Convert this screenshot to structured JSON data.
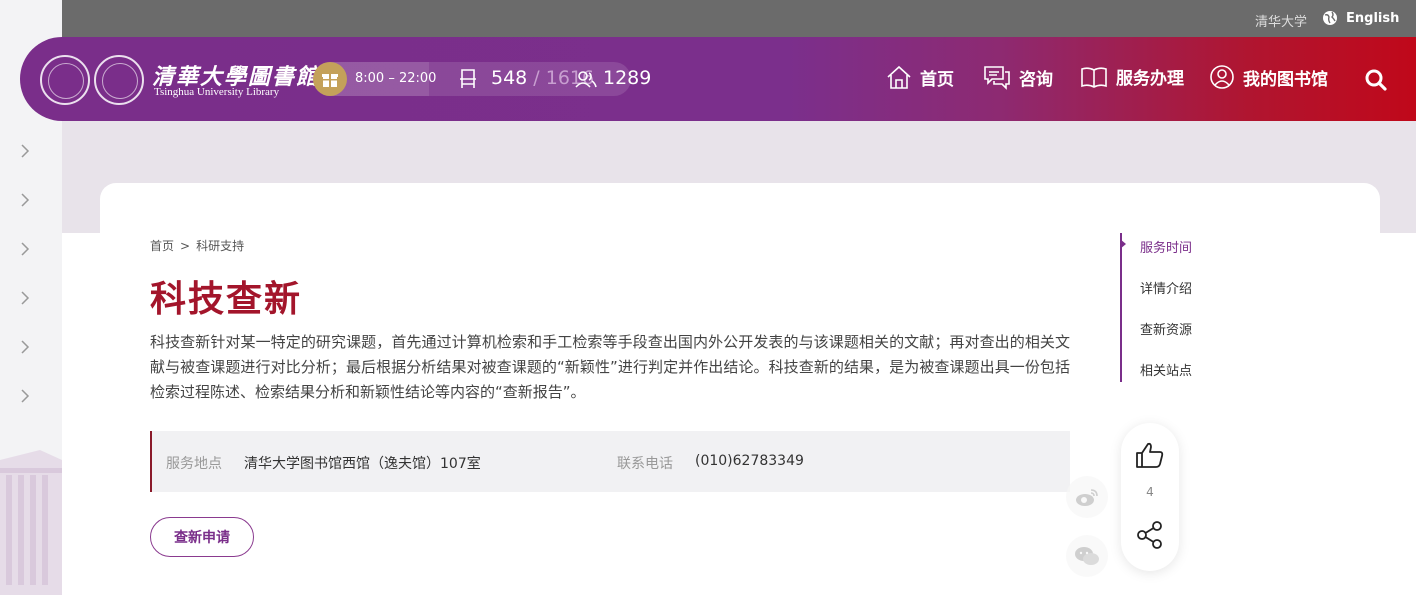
{
  "topbar": {
    "university_link": "清华大学",
    "language_label": "English"
  },
  "header": {
    "logo_cn": "清華大學圖書館",
    "logo_en": "Tsinghua University Library",
    "hours": "8:00 – 22:00",
    "seats_used": "548",
    "seats_sep": " / ",
    "seats_total": "1616",
    "visitors": "1289",
    "nav": [
      {
        "label": "首页",
        "icon": "home-icon"
      },
      {
        "label": "咨询",
        "icon": "chat-icon"
      },
      {
        "label": "服务办理",
        "icon": "book-icon"
      },
      {
        "label": "我的图书馆",
        "icon": "user-icon"
      }
    ],
    "search_icon": "search-icon"
  },
  "breadcrumb": {
    "home": "首页",
    "separator": ">",
    "current": "科研支持"
  },
  "page": {
    "title": "科技查新",
    "description": "科技查新针对某一特定的研究课题，首先通过计算机检索和手工检索等手段查出国内外公开发表的与该课题相关的文献；再对查出的相关文献与被查课题进行对比分析；最后根据分析结果对被查课题的“新颖性”进行判定并作出结论。科技查新的结果，是为被查课题出具一份包括检索过程陈述、检索结果分析和新颖性结论等内容的“查新报告”。",
    "location_label": "服务地点",
    "location_value": "清华大学图书馆西馆（逸夫馆）107室",
    "phone_label": "联系电话",
    "phone_value": "(010)62783349",
    "apply_button": "查新申请"
  },
  "toc": {
    "items": [
      "服务时间",
      "详情介绍",
      "查新资源",
      "相关站点"
    ],
    "active_index": 0
  },
  "social": {
    "like_count": "4"
  },
  "colors": {
    "brand_purple": "#7a2e8a",
    "brand_red": "#c0081a",
    "title_red": "#a3152b"
  }
}
